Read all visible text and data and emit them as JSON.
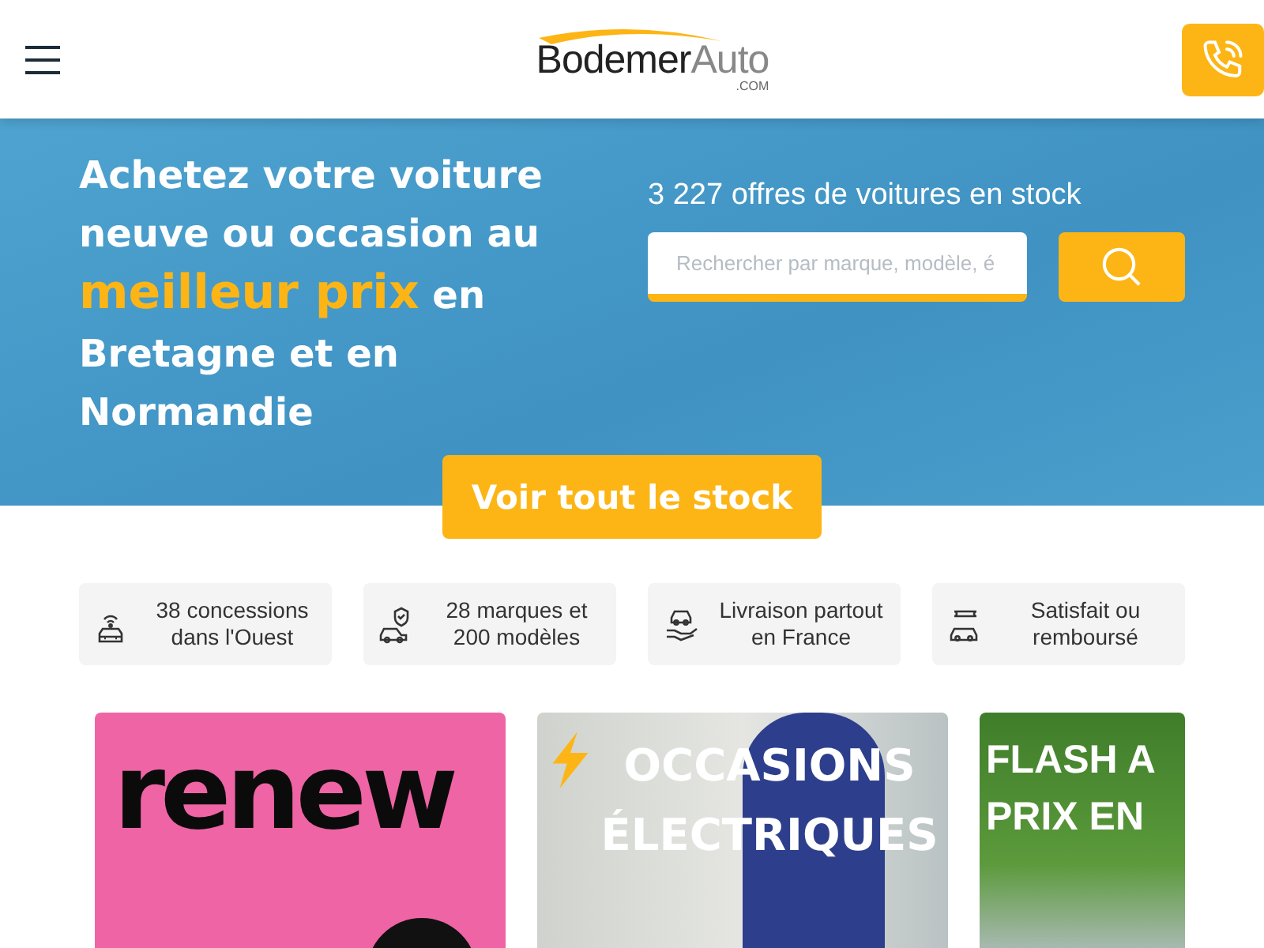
{
  "header": {
    "logo": {
      "name": "Bodemer",
      "suffix": "Auto",
      "domain": ".COM"
    }
  },
  "hero": {
    "headline": [
      {
        "text": "Achetez votre voiture neuve ou occasion au ",
        "highlight": false
      },
      {
        "text": "meilleur prix",
        "highlight": true
      },
      {
        "text": " en Bretagne et en Normandie",
        "highlight": false
      }
    ],
    "stock_count": "3 227 offres de voitures en stock",
    "search": {
      "placeholder": "Rechercher par marque, modèle, é"
    },
    "cta": "Voir tout le stock"
  },
  "features": [
    {
      "kind": "dealer",
      "text": "38 concessions dans l'Ouest"
    },
    {
      "kind": "brands",
      "text": "28 marques et 200 modèles"
    },
    {
      "kind": "delivery",
      "text": "Livraison partout en France"
    },
    {
      "kind": "refund",
      "text": "Satisfait ou remboursé"
    }
  ],
  "promos": [
    {
      "kind": "renew",
      "title": "renew"
    },
    {
      "kind": "electric",
      "title": "OCCASIONS ÉLECTRIQUES"
    },
    {
      "kind": "flash",
      "title_lines": [
        "FLASH A",
        "PRIX EN"
      ]
    }
  ]
}
